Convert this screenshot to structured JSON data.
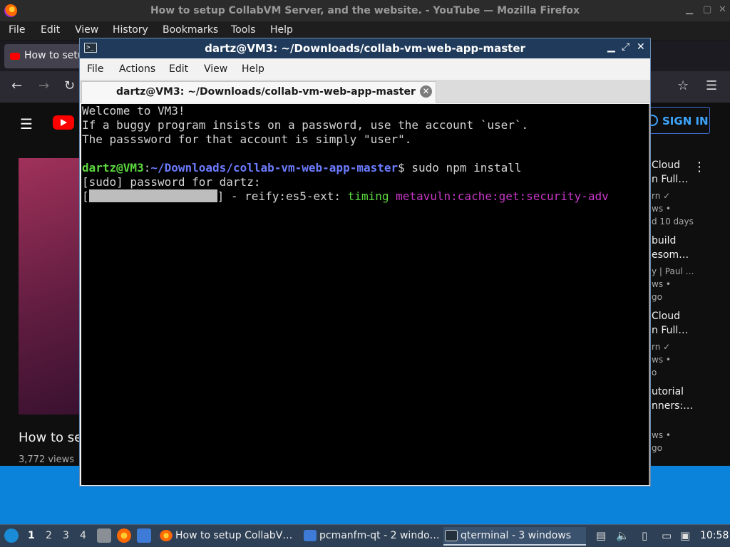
{
  "firefox": {
    "window_title": "How to setup CollabVM Server, and the website. - YouTube — Mozilla Firefox",
    "menu": [
      "File",
      "Edit",
      "View",
      "History",
      "Bookmarks",
      "Tools",
      "Help"
    ],
    "tab_title": "How to setu",
    "page": {
      "signin_label": "SIGN IN",
      "video_title": "How to set",
      "video_views": "3,772 views",
      "sidebar_lines": [
        "Cloud",
        "n Full…",
        "rn ✓",
        "ws •",
        "d 10 days",
        "build",
        "esom…",
        "y | Paul …",
        "ws •",
        "go",
        "Cloud",
        "n Full…",
        "rn ✓",
        "ws •",
        "o",
        "utorial",
        "nners:…",
        "ws •",
        "go"
      ]
    }
  },
  "terminal": {
    "window_title": "dartz@VM3: ~/Downloads/collab-vm-web-app-master",
    "menu": [
      "File",
      "Actions",
      "Edit",
      "View",
      "Help"
    ],
    "tab_label": "dartz@VM3: ~/Downloads/collab-vm-web-app-master",
    "lines": {
      "l1": "Welcome to VM3!",
      "l2": "If a buggy program insists on a password, use the account `user`.",
      "l3": "The passsword for that account is simply \"user\".",
      "prompt_user": "dartz@VM3",
      "prompt_sep": ":",
      "prompt_path": "~/Downloads/collab-vm-web-app-master",
      "prompt_cmd": "$ sudo npm install",
      "l5": "[sudo] password for dartz:",
      "progress_open": "[",
      "progress_close": "] - reify:es5-ext: ",
      "timing": "timing",
      "metavuln": " metavuln:cache:get:security-adv"
    }
  },
  "taskbar": {
    "workspaces": [
      "1",
      "2",
      "3",
      "4"
    ],
    "tasks": [
      {
        "label": "How to setup CollabV…",
        "icon": "firefox-icon"
      },
      {
        "label": "pcmanfm-qt - 2 windo…",
        "icon": "folder-icon"
      },
      {
        "label": "qterminal - 3 windows",
        "icon": "terminal-icon"
      }
    ],
    "clock": "10:58"
  }
}
